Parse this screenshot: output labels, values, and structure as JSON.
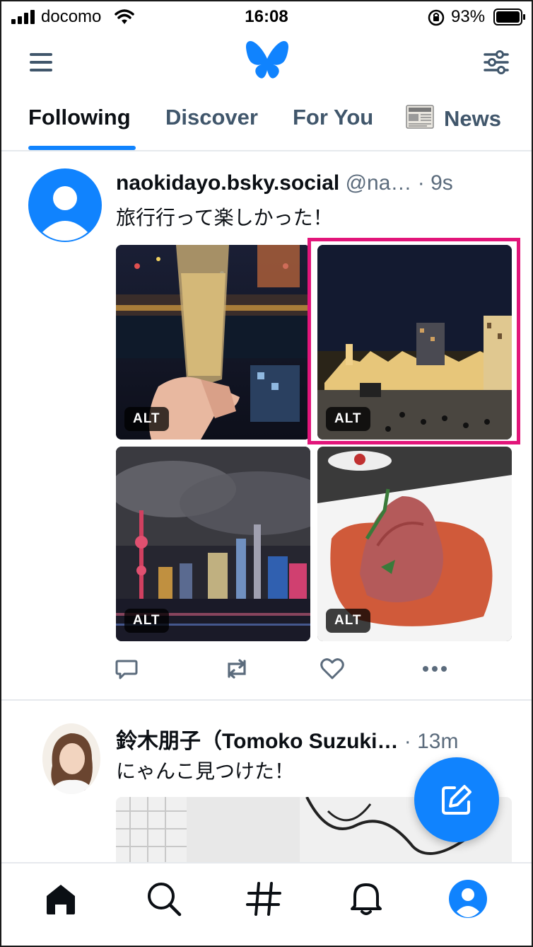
{
  "status_bar": {
    "carrier": "docomo",
    "time": "16:08",
    "battery": "93%"
  },
  "header": {
    "menu_icon": "hamburger-menu-icon",
    "logo": "butterfly-logo",
    "filter_icon": "sliders-icon"
  },
  "tabs": [
    {
      "label": "Following",
      "active": true
    },
    {
      "label": "Discover",
      "active": false
    },
    {
      "label": "For You",
      "active": false
    },
    {
      "label": "News",
      "active": false,
      "icon": "newspaper-icon"
    }
  ],
  "posts": [
    {
      "author_name": "naokidayo.bsky.social",
      "handle": "@na…",
      "separator": " · ",
      "time": "9s",
      "text": "旅行行って楽しかった！",
      "images": [
        {
          "alt_badge": "ALT",
          "subject": "champagne-glass-night-city"
        },
        {
          "alt_badge": "ALT",
          "subject": "night-building-square",
          "highlighted": true
        },
        {
          "alt_badge": "ALT",
          "subject": "night-skyline-tower"
        },
        {
          "alt_badge": "ALT",
          "subject": "roast-beef-plate"
        }
      ],
      "actions": [
        "reply-icon",
        "repost-icon",
        "like-icon",
        "more-icon"
      ]
    },
    {
      "author_name": "鈴木朋子（Tomoko Suzuki…",
      "separator": " · ",
      "time": "13m",
      "text": "にゃんこ見つけた！"
    }
  ],
  "fab_icon": "compose-icon",
  "bottom_nav": [
    "home-icon",
    "search-icon",
    "hashtag-icon",
    "notifications-icon",
    "profile-icon"
  ],
  "colors": {
    "accent": "#1083fe",
    "highlight": "#e2157a",
    "muted": "#40566b"
  }
}
